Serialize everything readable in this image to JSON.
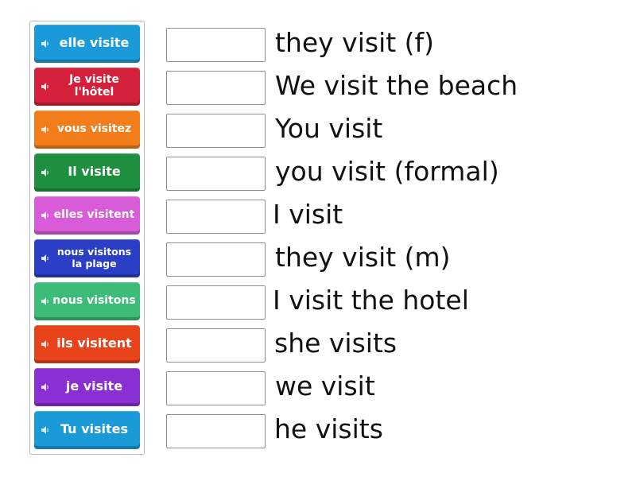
{
  "tiles": [
    {
      "label": "elle visite",
      "color": "#1a9ad9"
    },
    {
      "label": "Je visite l'hôtel",
      "color": "#d4203a"
    },
    {
      "label": "vous visitez",
      "color": "#f27d1a"
    },
    {
      "label": "Il visite",
      "color": "#1e8f3e"
    },
    {
      "label": "elles visitent",
      "color": "#d85bd8"
    },
    {
      "label": "nous visitons la plage",
      "color": "#2a3fc6"
    },
    {
      "label": "nous visitons",
      "color": "#3cbc78"
    },
    {
      "label": "ils visitent",
      "color": "#e8431a"
    },
    {
      "label": "je visite",
      "color": "#8a2fd4"
    },
    {
      "label": "Tu visites",
      "color": "#1a9ad9"
    }
  ],
  "targets": [
    {
      "label": "they visit (f)"
    },
    {
      "label": "We visit the beach"
    },
    {
      "label": "You visit"
    },
    {
      "label": "you visit (formal)"
    },
    {
      "label": "I visit"
    },
    {
      "label": "they visit (m)"
    },
    {
      "label": "I visit the hotel"
    },
    {
      "label": "she visits"
    },
    {
      "label": "we visit"
    },
    {
      "label": "he visits"
    }
  ],
  "icons": {
    "tile_icon": "speaker-icon"
  }
}
